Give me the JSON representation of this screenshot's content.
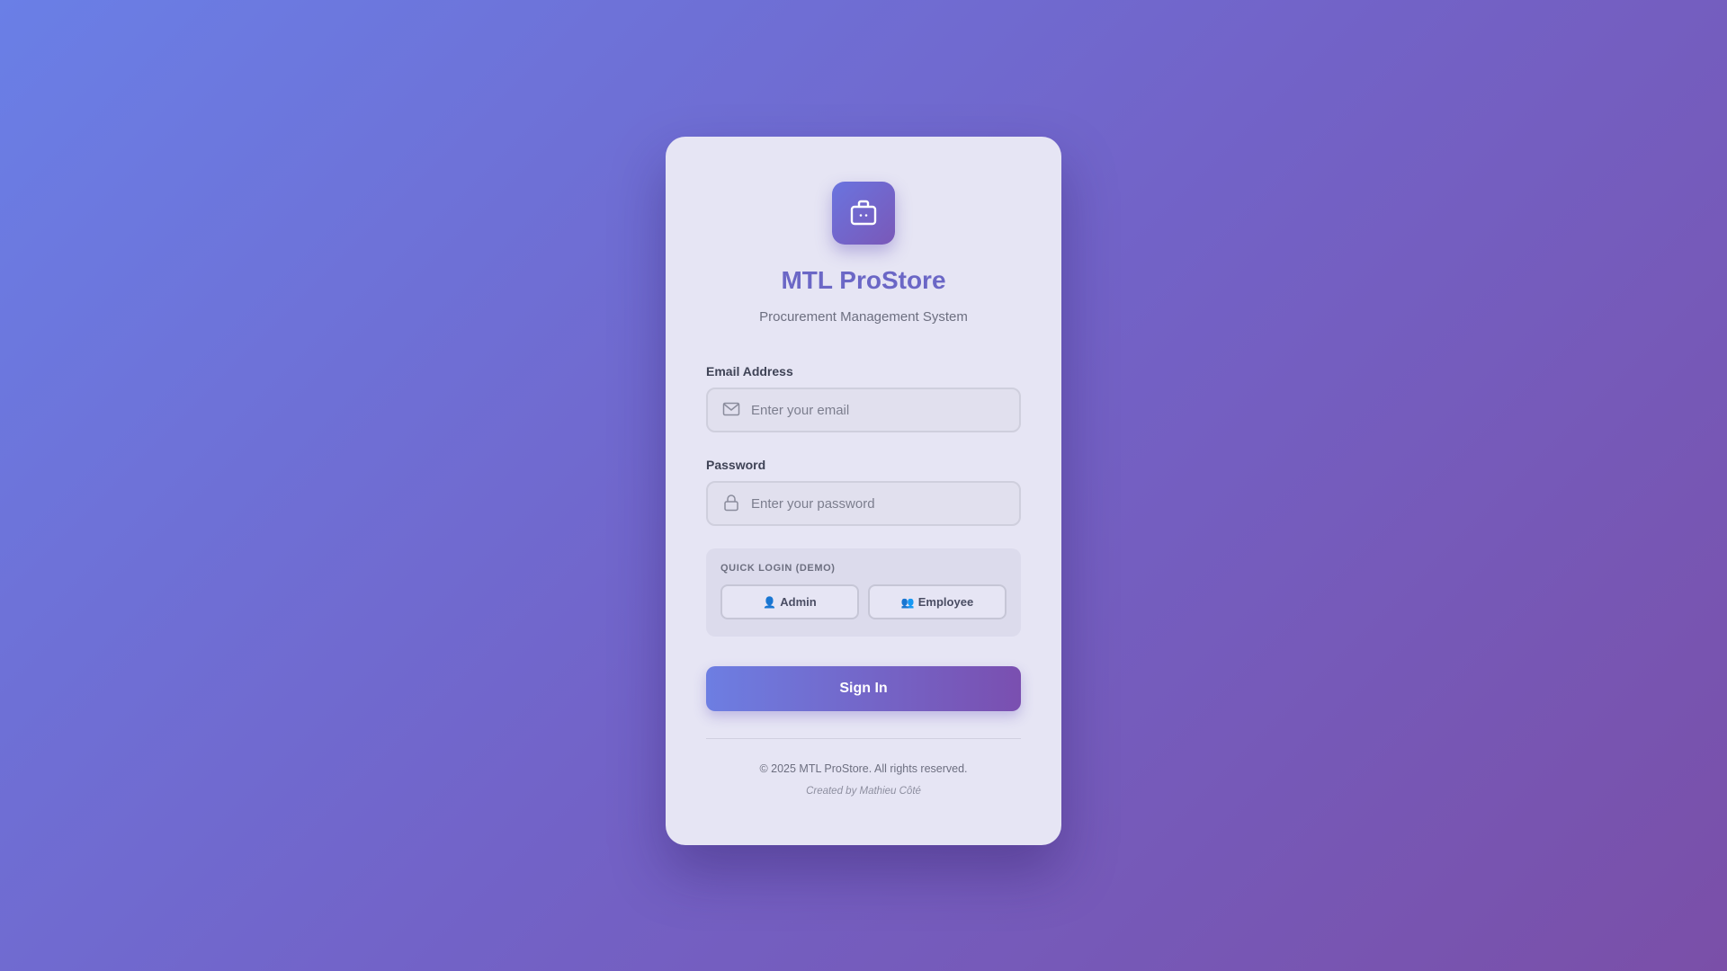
{
  "app": {
    "name": "MTL ProStore",
    "subtitle": "Procurement Management System",
    "logo_icon": "briefcase-icon"
  },
  "form": {
    "email": {
      "label": "Email Address",
      "placeholder": "Enter your email",
      "value": "",
      "icon": "mail-icon"
    },
    "password": {
      "label": "Password",
      "placeholder": "Enter your password",
      "value": "",
      "icon": "lock-icon"
    },
    "quick_login": {
      "label": "QUICK LOGIN (DEMO)",
      "admin": {
        "emoji": "👤",
        "label": "Admin"
      },
      "employee": {
        "emoji": "👥",
        "label": "Employee"
      }
    },
    "submit_label": "Sign In"
  },
  "footer": {
    "copyright": "© 2025 MTL ProStore. All rights reserved.",
    "credit": "Created by Mathieu Côté"
  },
  "colors": {
    "accent": "#6b67c6",
    "gradient_start": "#6a7fe6",
    "gradient_end": "#7a4fa8",
    "card_bg": "#e6e5f4"
  }
}
